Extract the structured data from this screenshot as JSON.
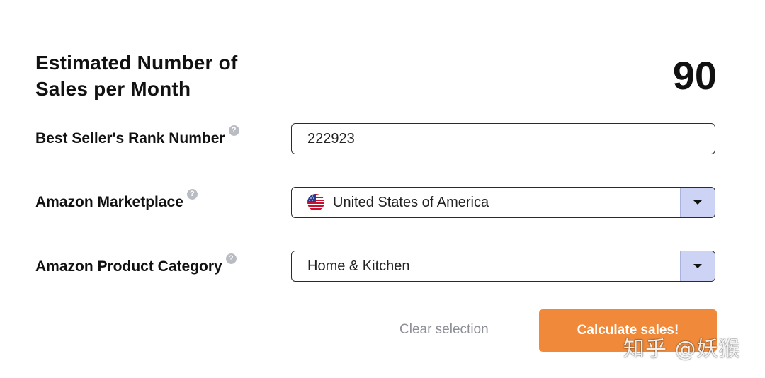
{
  "header": {
    "title": "Estimated Number of Sales per Month",
    "result_value": "90"
  },
  "form": {
    "bsr": {
      "label": "Best Seller's Rank Number",
      "value": "222923"
    },
    "marketplace": {
      "label": "Amazon Marketplace",
      "value": "United States of America",
      "flag_icon": "us-flag-icon"
    },
    "category": {
      "label": "Amazon Product Category",
      "value": "Home & Kitchen"
    },
    "help_glyph": "?"
  },
  "actions": {
    "clear_label": "Clear selection",
    "calculate_label": "Calculate sales!"
  },
  "watermark": "知乎 @妖猴",
  "colors": {
    "accent_button": "#f08a3a",
    "dropdown_button": "#ccd3f5",
    "muted_text": "#8c8f96"
  }
}
